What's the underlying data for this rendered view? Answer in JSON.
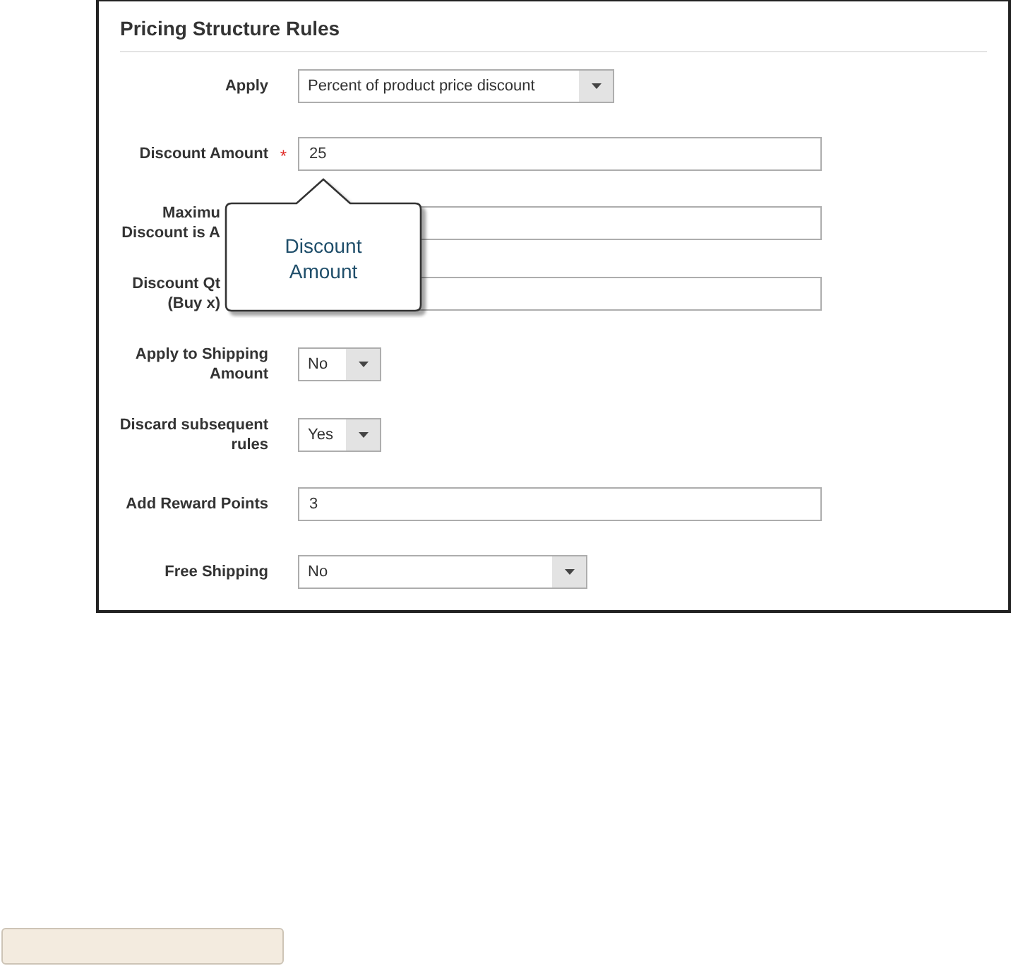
{
  "panel": {
    "title": "Pricing Structure Rules",
    "fields": [
      {
        "label": "Apply",
        "kind": "select",
        "value": "Percent of product price discount"
      },
      {
        "label": "Discount Amount",
        "kind": "text",
        "value": "25",
        "required_mark": "*"
      },
      {
        "label": "Maximu\nDiscount is A",
        "kind": "text"
      },
      {
        "label": "Discount Qt\n(Buy x)",
        "kind": "text"
      },
      {
        "label": "Apply to Shipping\nAmount",
        "kind": "select",
        "value": "No"
      },
      {
        "label": "Discard subsequent\nrules",
        "kind": "select",
        "value": "Yes"
      },
      {
        "label": "Add Reward Points",
        "kind": "text",
        "value": "3"
      },
      {
        "label": "Free Shipping",
        "kind": "select",
        "value": "No"
      }
    ]
  },
  "callout": {
    "text": "Discount\nAmount"
  }
}
